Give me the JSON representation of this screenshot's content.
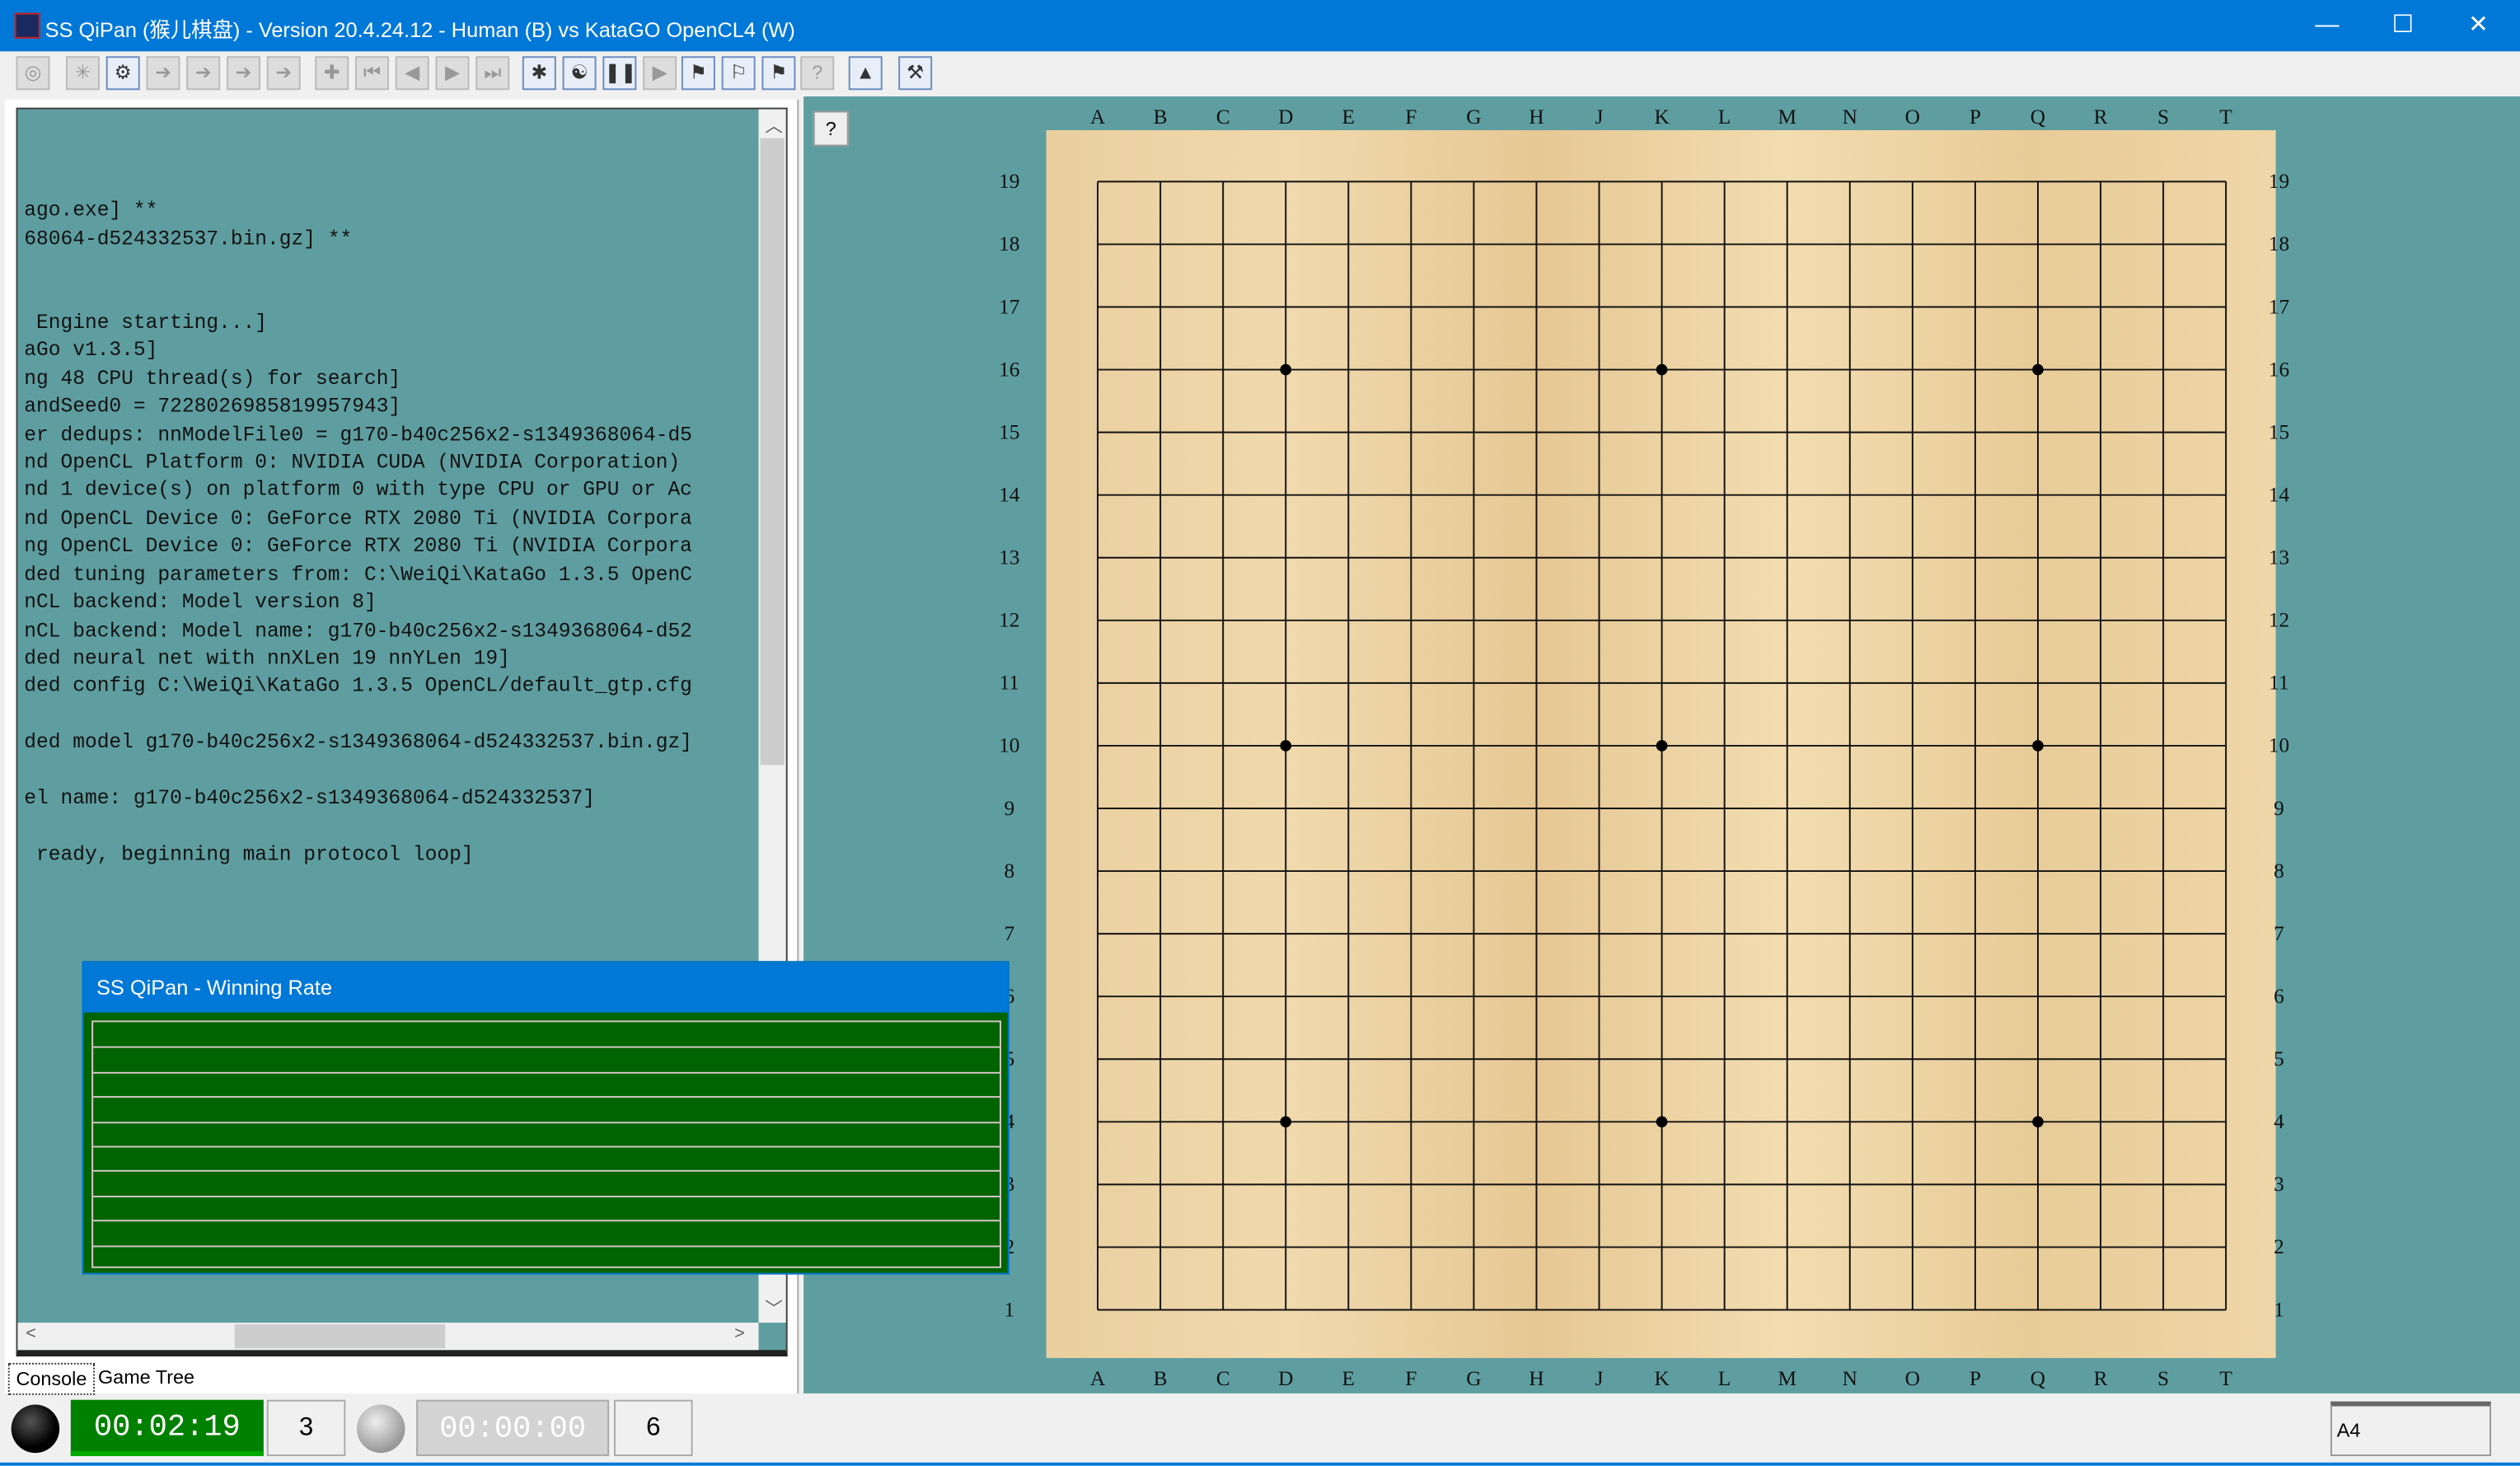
{
  "window": {
    "title": "SS QiPan (猴儿棋盘) - Version 20.4.24.12 - Human (B) vs KataGO OpenCL4 (W)",
    "minimize": "—",
    "maximize": "☐",
    "close": "✕"
  },
  "toolbar": [
    {
      "name": "engine-icon",
      "glyph": "◎",
      "on": false
    },
    {
      "name": "new-icon",
      "glyph": "✳",
      "on": false
    },
    {
      "name": "setup-icon",
      "glyph": "⚙",
      "on": true
    },
    {
      "name": "next-variation-icon",
      "glyph": "➔",
      "on": false
    },
    {
      "name": "prev-variation-icon",
      "glyph": "➔",
      "on": false
    },
    {
      "name": "forward-icon",
      "glyph": "➔",
      "on": false
    },
    {
      "name": "back-icon",
      "glyph": "➔",
      "on": false
    },
    {
      "name": "add-icon",
      "glyph": "✚",
      "on": false
    },
    {
      "name": "first-move-icon",
      "glyph": "⏮",
      "on": false
    },
    {
      "name": "prev-move-icon",
      "glyph": "◀",
      "on": false
    },
    {
      "name": "next-move-icon",
      "glyph": "▶",
      "on": false
    },
    {
      "name": "last-move-icon",
      "glyph": "⏭",
      "on": false
    },
    {
      "name": "analyze-icon",
      "glyph": "✱",
      "on": true
    },
    {
      "name": "yinyang-icon",
      "glyph": "☯",
      "on": true
    },
    {
      "name": "pause-icon",
      "glyph": "❚❚",
      "on": true
    },
    {
      "name": "play-icon",
      "glyph": "▶",
      "on": false
    },
    {
      "name": "green-flag-icon",
      "glyph": "⚑",
      "on": true
    },
    {
      "name": "white-flag-icon",
      "glyph": "⚐",
      "on": true
    },
    {
      "name": "red-flag-icon",
      "glyph": "⚑",
      "on": true
    },
    {
      "name": "hint-icon",
      "glyph": "?",
      "on": false
    },
    {
      "name": "picture-icon",
      "glyph": "▲",
      "on": true
    },
    {
      "name": "tools-icon",
      "glyph": "⚒",
      "on": true
    }
  ],
  "console": {
    "lines": "\nago.exe] **\n68064-d524332537.bin.gz] **\n\n\n Engine starting...]\naGo v1.3.5]\nng 48 CPU thread(s) for search]\nandSeed0 = 7228026985819957943]\ner dedups: nnModelFile0 = g170-b40c256x2-s1349368064-d5\nnd OpenCL Platform 0: NVIDIA CUDA (NVIDIA Corporation)\nnd 1 device(s) on platform 0 with type CPU or GPU or Ac\nnd OpenCL Device 0: GeForce RTX 2080 Ti (NVIDIA Corpora\nng OpenCL Device 0: GeForce RTX 2080 Ti (NVIDIA Corpora\nded tuning parameters from: C:\\WeiQi\\KataGo 1.3.5 OpenC\nnCL backend: Model version 8]\nnCL backend: Model name: g170-b40c256x2-s1349368064-d52\nded neural net with nnXLen 19 nnYLen 19]\nded config C:\\WeiQi\\KataGo 1.3.5 OpenCL/default_gtp.cfg\n\nded model g170-b40c256x2-s1349368064-d524332537.bin.gz]\n\nel name: g170-b40c256x2-s1349368064-d524332537]\n\n ready, beginning main protocol loop]"
  },
  "tabs": {
    "console": "Console",
    "game_tree": "Game Tree"
  },
  "help_label": "?",
  "board": {
    "columns": [
      "A",
      "B",
      "C",
      "D",
      "E",
      "F",
      "G",
      "H",
      "J",
      "K",
      "L",
      "M",
      "N",
      "O",
      "P",
      "Q",
      "R",
      "S",
      "T"
    ],
    "rows": [
      "19",
      "18",
      "17",
      "16",
      "15",
      "14",
      "13",
      "12",
      "11",
      "10",
      "9",
      "8",
      "7",
      "6",
      "5",
      "4",
      "3",
      "2",
      "1"
    ],
    "star_points": [
      [
        3,
        3
      ],
      [
        9,
        3
      ],
      [
        15,
        3
      ],
      [
        3,
        9
      ],
      [
        9,
        9
      ],
      [
        15,
        9
      ],
      [
        3,
        15
      ],
      [
        9,
        15
      ],
      [
        15,
        15
      ]
    ]
  },
  "winrate": {
    "title": "SS QiPan - Winning Rate",
    "gridlines": 10
  },
  "status": {
    "black_time": "00:02:19",
    "black_count": "3",
    "white_time": "00:00:00",
    "white_count": "6",
    "coordinate": "A4"
  },
  "colors": {
    "teal": "#5f9ea0",
    "title_blue": "#0078d7",
    "clock_green": "#008000",
    "winrate_green": "#006400"
  }
}
